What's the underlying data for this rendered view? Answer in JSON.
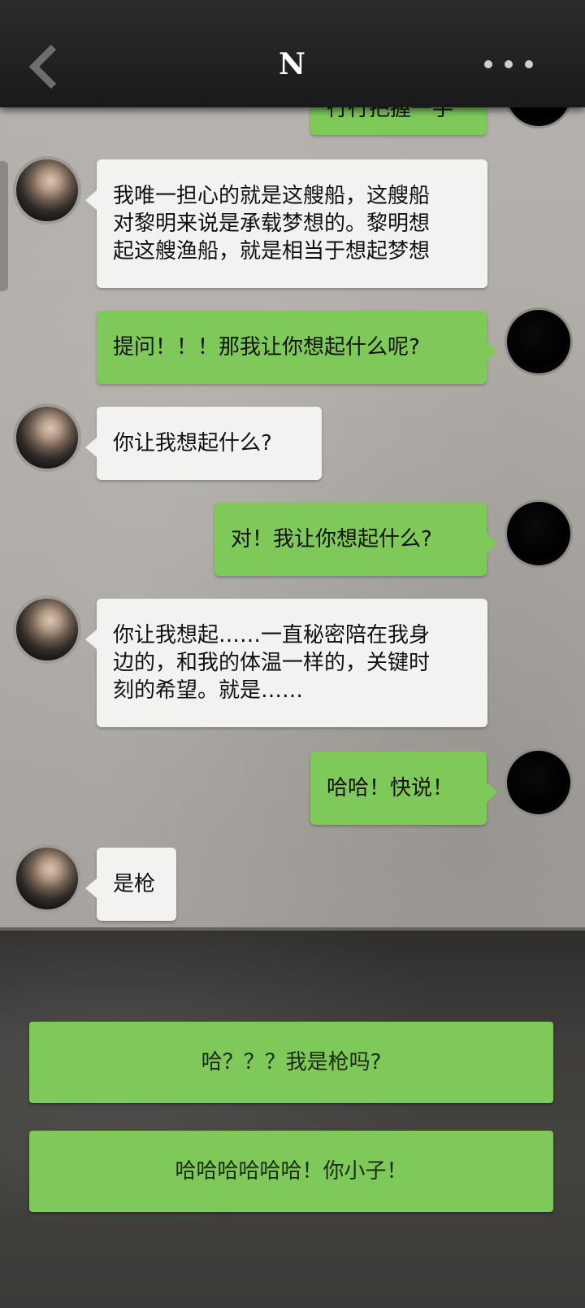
{
  "header": {
    "title": "N",
    "back_icon": "chevron-left-icon",
    "more_icon": "more-dots-icon"
  },
  "messages": [
    {
      "sender": "me",
      "lines": [
        "行行把握一手"
      ],
      "partial": true
    },
    {
      "sender": "other",
      "lines": [
        "我唯一担心的就是这艘船，这艘船",
        "对黎明来说是承载梦想的。黎明想",
        "起这艘渔船，就是相当于想起梦想"
      ]
    },
    {
      "sender": "me",
      "lines": [
        "提问！！！那我让你想起什么呢?"
      ]
    },
    {
      "sender": "other",
      "lines": [
        "你让我想起什么?"
      ]
    },
    {
      "sender": "me",
      "lines": [
        "对！我让你想起什么?"
      ]
    },
    {
      "sender": "other",
      "lines": [
        "你让我想起……一直秘密陪在我身",
        "边的，和我的体温一样的，关键时",
        "刻的希望。就是……"
      ]
    },
    {
      "sender": "me",
      "lines": [
        "哈哈！快说！"
      ]
    },
    {
      "sender": "other",
      "lines": [
        "是枪"
      ]
    }
  ],
  "choices": [
    {
      "label": "哈？？？我是枪吗?"
    },
    {
      "label": "哈哈哈哈哈哈！你小子！"
    }
  ],
  "colors": {
    "bubble_me": "#7fc95b",
    "bubble_other": "#f2f2f1",
    "header_bg": "#222222"
  }
}
